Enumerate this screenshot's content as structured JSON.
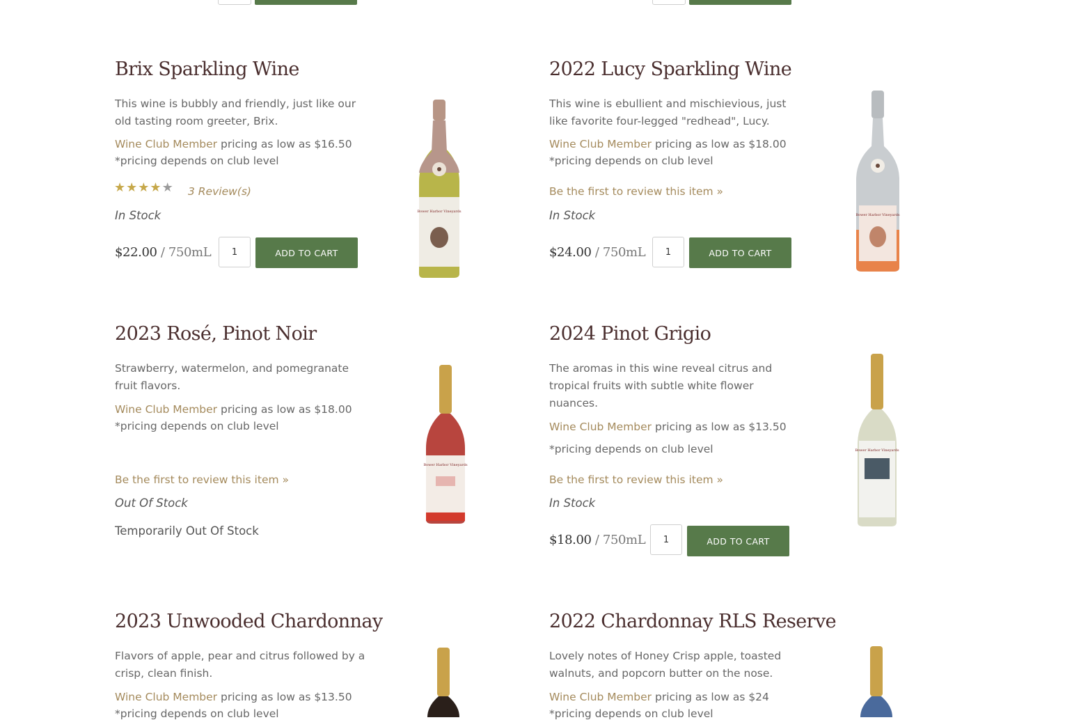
{
  "products": [
    {
      "title": "Brix Sparkling Wine",
      "description": "This wine is bubbly and friendly, just like our old tasting room greeter, Brix.",
      "club_link": "Wine Club Member",
      "club_text": " pricing as low as $16.50",
      "club_note": "*pricing depends on club level",
      "rating": 4.5,
      "reviews": "3 Review(s)",
      "stock": "In Stock",
      "price": "$22.00",
      "unit": " / 750mL",
      "qty": "1",
      "button": "ADD TO CART"
    },
    {
      "title": "2022 Lucy Sparkling Wine",
      "description": "This wine is ebullient and mischievious, just like favorite four-legged \"redhead\", Lucy.",
      "club_link": "Wine Club Member",
      "club_text": " pricing as low as $18.00",
      "club_note": "*pricing depends on club level",
      "review_link": "Be the first to review this item »",
      "stock": "In Stock",
      "price": "$24.00",
      "unit": " / 750mL",
      "qty": "1",
      "button": "ADD TO CART"
    },
    {
      "title": "2023 Rosé, Pinot Noir",
      "description": "Strawberry, watermelon, and pomegranate fruit flavors.",
      "club_link": "Wine Club Member",
      "club_text": " pricing as low as $18.00",
      "club_note": "*pricing depends on club level",
      "review_link": "Be the first to review this item »",
      "stock": "Out Of Stock",
      "stock_message": "Temporarily Out Of Stock"
    },
    {
      "title": "2024 Pinot Grigio",
      "description": "The aromas in this wine reveal citrus and tropical fruits with subtle white flower nuances.",
      "club_link": "Wine Club Member",
      "club_text": " pricing as low as $13.50",
      "club_note": "*pricing depends on club level",
      "review_link": "Be the first to review this item »",
      "stock": "In Stock",
      "price": "$18.00",
      "unit": " / 750mL",
      "qty": "1",
      "button": "ADD TO CART"
    },
    {
      "title": "2023 Unwooded Chardonnay",
      "description": "Flavors of apple, pear and citrus followed by a crisp, clean finish.",
      "club_link": "Wine Club Member",
      "club_text": " pricing as low as $13.50",
      "club_note": "*pricing depends on club level"
    },
    {
      "title": "2022 Chardonnay RLS Reserve",
      "description": "Lovely notes of Honey Crisp apple, toasted walnuts, and popcorn butter on the nose.",
      "club_link": "Wine Club Member",
      "club_text": " pricing as low as $24",
      "club_note": "*pricing depends on club level"
    }
  ],
  "bottle_label_text": "Bower Harbor Vineyards",
  "colors": {
    "accent_green": "#577a4a",
    "title_brown": "#4a2e2e",
    "link_gold": "#a48a5c",
    "star_gold": "#c6a84a"
  }
}
